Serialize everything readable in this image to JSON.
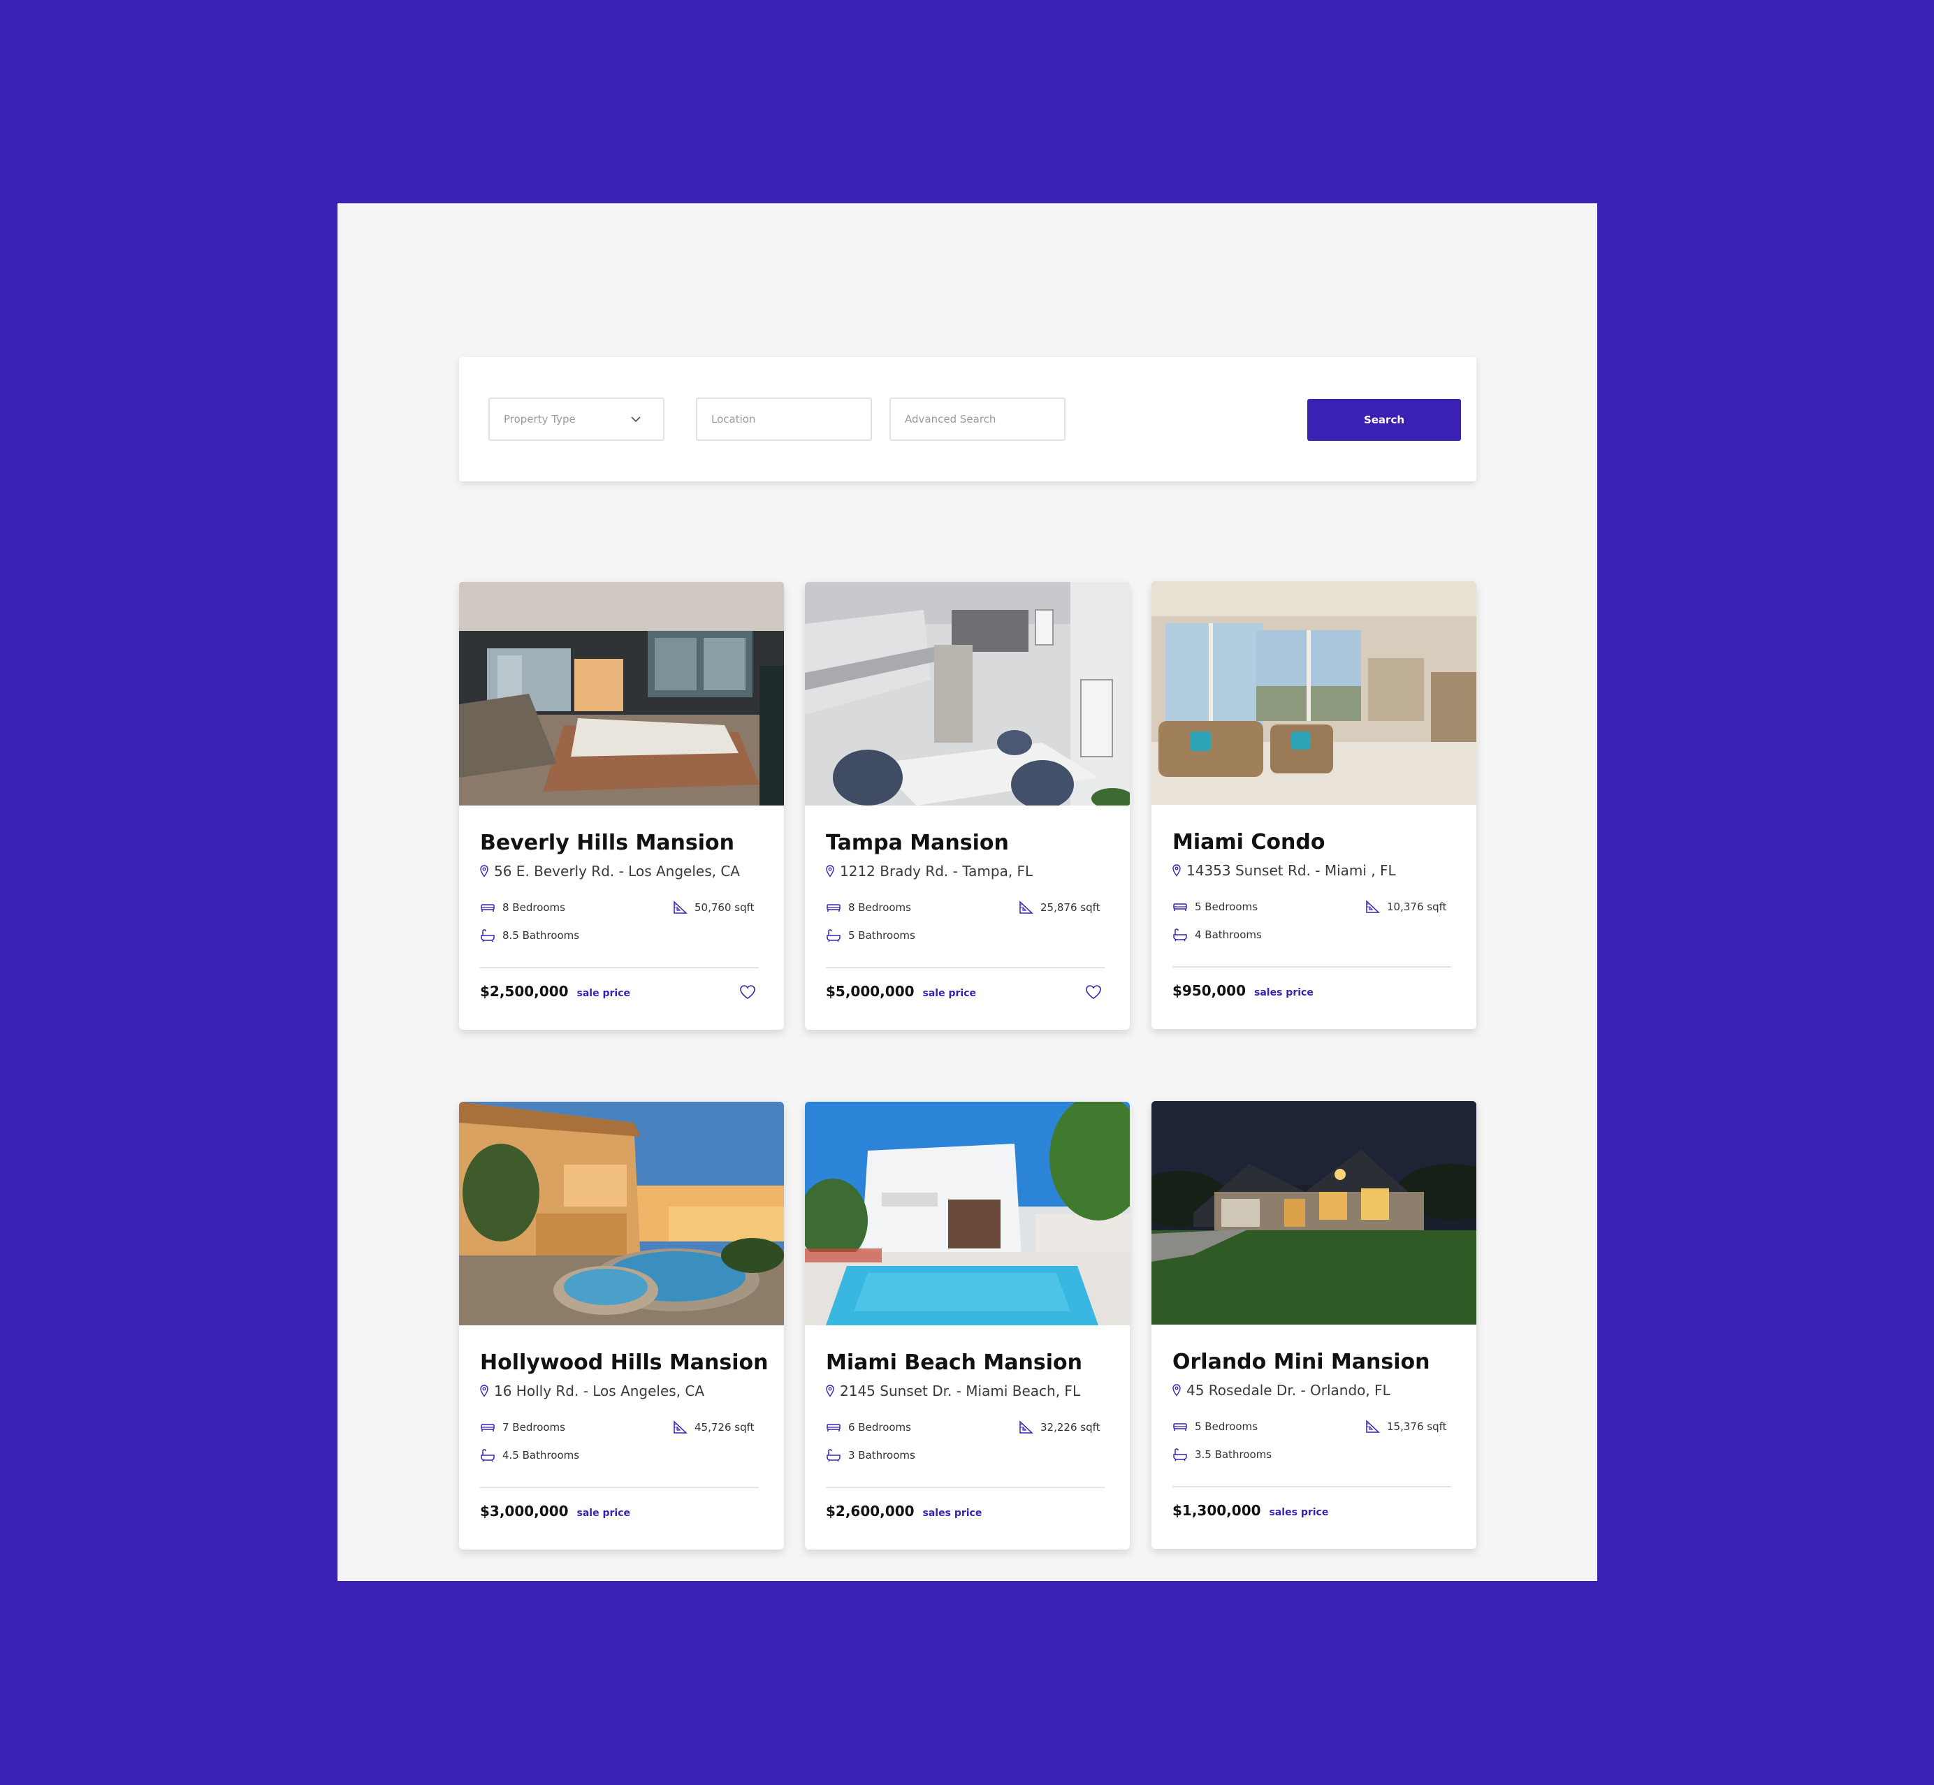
{
  "search": {
    "property_type_placeholder": "Property Type",
    "location_placeholder": "Location",
    "advanced_placeholder": "Advanced Search",
    "button_label": "Search"
  },
  "colors": {
    "accent": "#3a21b3",
    "background": "#f5f5f6",
    "card": "#ffffff"
  },
  "listings": [
    {
      "title": "Beverly Hills Mansion",
      "address": "56 E. Beverly Rd. - Los Angeles, CA",
      "bedrooms": "8 Bedrooms",
      "bathrooms": "8.5 Bathrooms",
      "sqft": "50,760 sqft",
      "price": "$2,500,000",
      "price_label": "sale price",
      "favorite_icon": "heart-icon"
    },
    {
      "title": "Tampa Mansion",
      "address": "1212 Brady Rd. - Tampa, FL",
      "bedrooms": "8 Bedrooms",
      "bathrooms": "5 Bathrooms",
      "sqft": "25,876 sqft",
      "price": "$5,000,000",
      "price_label": "sale price",
      "favorite_icon": "heart-icon"
    },
    {
      "title": "Miami Condo",
      "address": "14353 Sunset Rd. - Miami , FL",
      "bedrooms": "5 Bedrooms",
      "bathrooms": "4 Bathrooms",
      "sqft": "10,376 sqft",
      "price": "$950,000",
      "price_label": "sales price"
    },
    {
      "title": "Hollywood Hills Mansion",
      "address": "16 Holly Rd. - Los Angeles, CA",
      "bedrooms": "7 Bedrooms",
      "bathrooms": "4.5 Bathrooms",
      "sqft": "45,726 sqft",
      "price": "$3,000,000",
      "price_label": "sale price"
    },
    {
      "title": "Miami Beach Mansion",
      "address": "2145 Sunset Dr. - Miami Beach, FL",
      "bedrooms": "6 Bedrooms",
      "bathrooms": "3 Bathrooms",
      "sqft": "32,226 sqft",
      "price": "$2,600,000",
      "price_label": "sales price"
    },
    {
      "title": "Orlando Mini Mansion",
      "address": "45 Rosedale Dr. - Orlando, FL",
      "bedrooms": "5 Bedrooms",
      "bathrooms": "3.5 Bathrooms",
      "sqft": "15,376 sqft",
      "price": "$1,300,000",
      "price_label": "sales price"
    }
  ]
}
